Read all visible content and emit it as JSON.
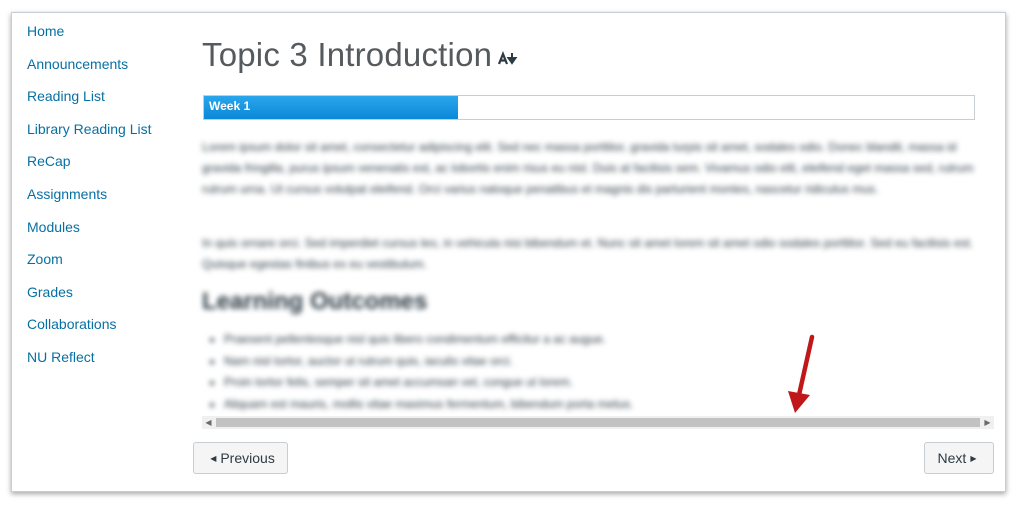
{
  "sidebar": {
    "items": [
      {
        "label": "Home"
      },
      {
        "label": "Announcements"
      },
      {
        "label": "Reading List"
      },
      {
        "label": "Library Reading List"
      },
      {
        "label": "ReCap"
      },
      {
        "label": "Assignments"
      },
      {
        "label": "Modules"
      },
      {
        "label": "Zoom"
      },
      {
        "label": "Grades"
      },
      {
        "label": "Collaborations"
      },
      {
        "label": "NU Reflect"
      }
    ]
  },
  "page": {
    "title": "Topic 3 Introduction",
    "title_icon": "sort-icon"
  },
  "progress": {
    "label": "Week 1",
    "value_fraction": 0.33,
    "color": "#0b88d7"
  },
  "content": {
    "paragraph1": "Lorem ipsum dolor sit amet, consectetur adipiscing elit. Sed nec massa porttitor, gravida turpis sit amet, sodales odio. Donec blandit, massa id gravida fringilla, purus ipsum venenatis est, ac lobortis enim risus eu nisl. Duis at facilisis sem. Vivamus odio elit, eleifend eget massa sed, rutrum rutrum urna. Ut cursus volutpat eleifend. Orci varius natoque penatibus et magnis dis parturient montes, nascetur ridiculus mus.",
    "paragraph2": "In quis ornare orci. Sed imperdiet cursus leo, in vehicula nisi bibendum et. Nunc sit amet lorem sit amet odio sodales porttitor. Sed eu facilisis est. Quisque egestas finibus ex eu vestibulum.",
    "heading": "Learning Outcomes",
    "outcomes": [
      "Praesent pellentesque nisl quis libero condimentum efficitur a ac augue.",
      "Nam nisl tortor, auctor ut rutrum quis, iaculis vitae orci.",
      "Proin tortor felis, semper sit amet accumsan vel, congue ut lorem.",
      "Aliquam est mauris, mollis vitae maximus fermentum, bibendum porta metus."
    ]
  },
  "footer": {
    "previous_label": "Previous",
    "next_label": "Next"
  },
  "colors": {
    "link": "#0770a3",
    "annotation_arrow": "#c0181a"
  }
}
